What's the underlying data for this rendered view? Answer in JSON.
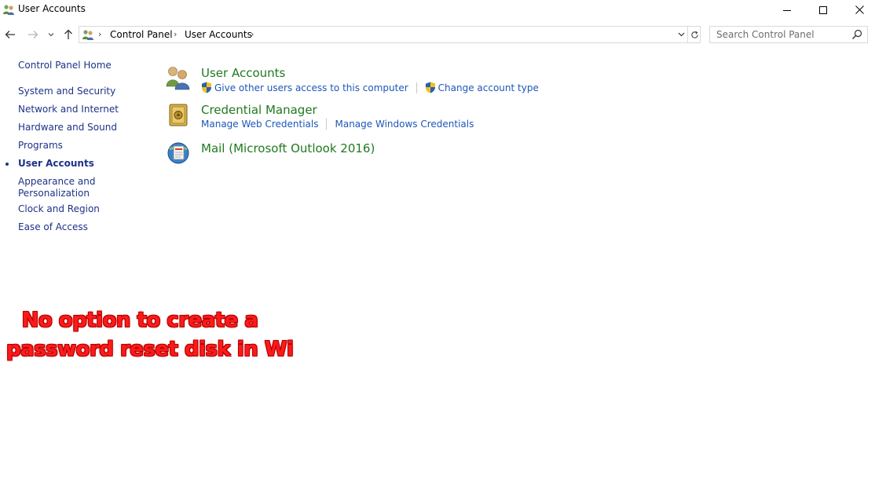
{
  "window": {
    "title": "User Accounts",
    "controls": {
      "minimize": "minimize-icon",
      "maximize": "maximize-icon",
      "close": "close-icon"
    }
  },
  "nav": {
    "back_icon": "arrow-left-icon",
    "forward_icon": "arrow-right-icon",
    "recent_icon": "chevron-down-icon",
    "up_icon": "arrow-up-icon"
  },
  "address": {
    "crumbs": [
      "Control Panel",
      "User Accounts"
    ],
    "separator": "›"
  },
  "search": {
    "placeholder": "Search Control Panel",
    "value": ""
  },
  "sidebar": {
    "home": "Control Panel Home",
    "items": [
      {
        "label": "System and Security",
        "current": false
      },
      {
        "label": "Network and Internet",
        "current": false
      },
      {
        "label": "Hardware and Sound",
        "current": false
      },
      {
        "label": "Programs",
        "current": false
      },
      {
        "label": "User Accounts",
        "current": true
      },
      {
        "label": "Appearance and",
        "label2": "Personalization",
        "current": false
      },
      {
        "label": "Clock and Region",
        "current": false
      },
      {
        "label": "Ease of Access",
        "current": false
      }
    ]
  },
  "categories": [
    {
      "title": "User Accounts",
      "icon": "users-icon",
      "links": [
        {
          "label": "Give other users access to this computer",
          "shield": true
        },
        {
          "label": "Change account type",
          "shield": true
        }
      ]
    },
    {
      "title": "Credential Manager",
      "icon": "vault-icon",
      "links": [
        {
          "label": "Manage Web Credentials",
          "shield": false
        },
        {
          "label": "Manage Windows Credentials",
          "shield": false
        }
      ]
    },
    {
      "title": "Mail (Microsoft Outlook 2016)",
      "icon": "mail-icon",
      "links": []
    }
  ],
  "overlay": {
    "line1": "No option to create a",
    "line2": "password reset disk in Wi"
  },
  "colors": {
    "link": "#1e57b8",
    "category": "#1f7a1f",
    "sidebar": "#1e3287",
    "overlay": "#ff1a1a"
  }
}
